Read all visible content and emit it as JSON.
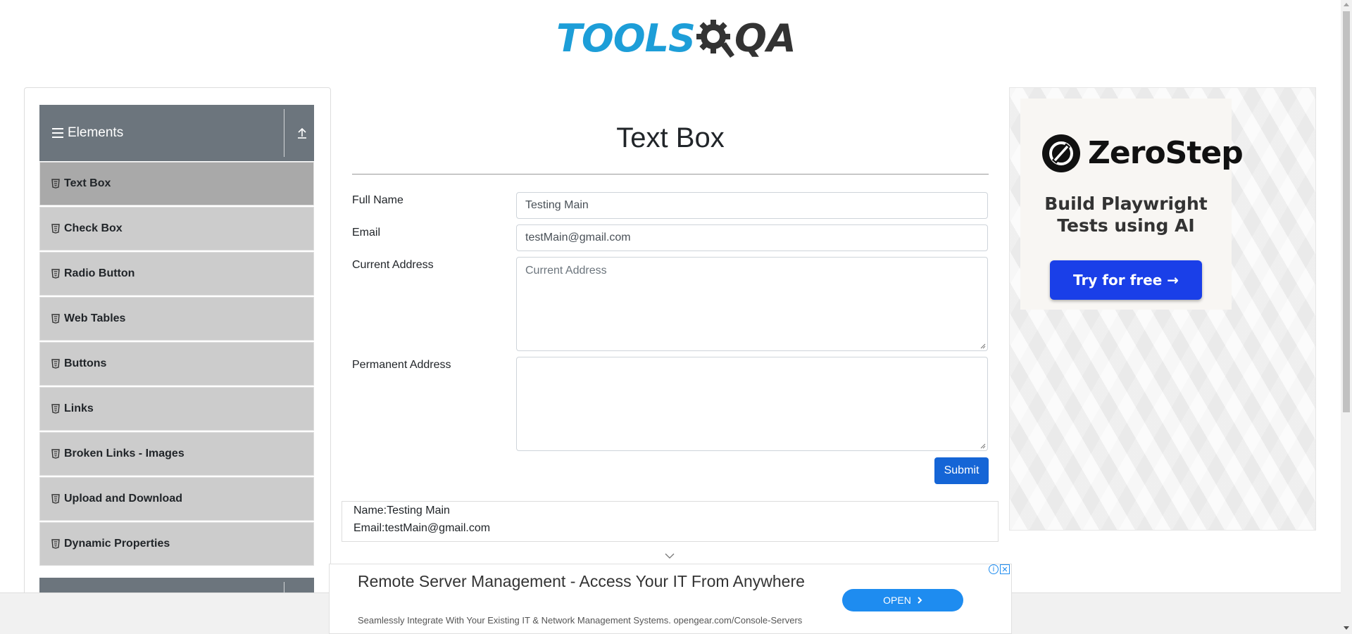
{
  "header": {
    "logo_tools": "TOOLS",
    "logo_qa": "QA"
  },
  "sidebar": {
    "group_title": "Elements",
    "items": [
      {
        "label": "Text Box",
        "active": true
      },
      {
        "label": "Check Box"
      },
      {
        "label": "Radio Button"
      },
      {
        "label": "Web Tables"
      },
      {
        "label": "Buttons"
      },
      {
        "label": "Links"
      },
      {
        "label": "Broken Links - Images"
      },
      {
        "label": "Upload and Download"
      },
      {
        "label": "Dynamic Properties"
      }
    ]
  },
  "main": {
    "title": "Text Box",
    "form": {
      "full_name_label": "Full Name",
      "full_name_value": "Testing Main",
      "email_label": "Email",
      "email_value": "testMain@gmail.com",
      "current_address_label": "Current Address",
      "current_address_placeholder": "Current Address",
      "permanent_address_label": "Permanent Address",
      "permanent_address_value": "",
      "submit_label": "Submit"
    },
    "output": {
      "name_line": "Name:Testing Main",
      "email_line": "Email:testMain@gmail.com"
    }
  },
  "right_ad": {
    "brand": "ZeroStep",
    "tagline_1": "Build Playwright",
    "tagline_2": "Tests using AI",
    "cta": "Try for free →"
  },
  "bottom_ad": {
    "title": "Remote Server Management - Access Your IT From Anywhere",
    "subtitle": "Seamlessly Integrate With Your Existing IT & Network Management Systems. opengear.com/Console-Servers",
    "cta": "OPEN",
    "info_icon": "info-icon",
    "close_icon": "close-icon"
  },
  "colors": {
    "brand_blue": "#1d9ed8",
    "sidebar_header": "#6c757d",
    "menu_item": "#cccccc",
    "menu_active": "#a9a9a9",
    "submit": "#1565d6",
    "zerostep_button": "#1a3fe8",
    "open_button": "#1e8cf0"
  }
}
